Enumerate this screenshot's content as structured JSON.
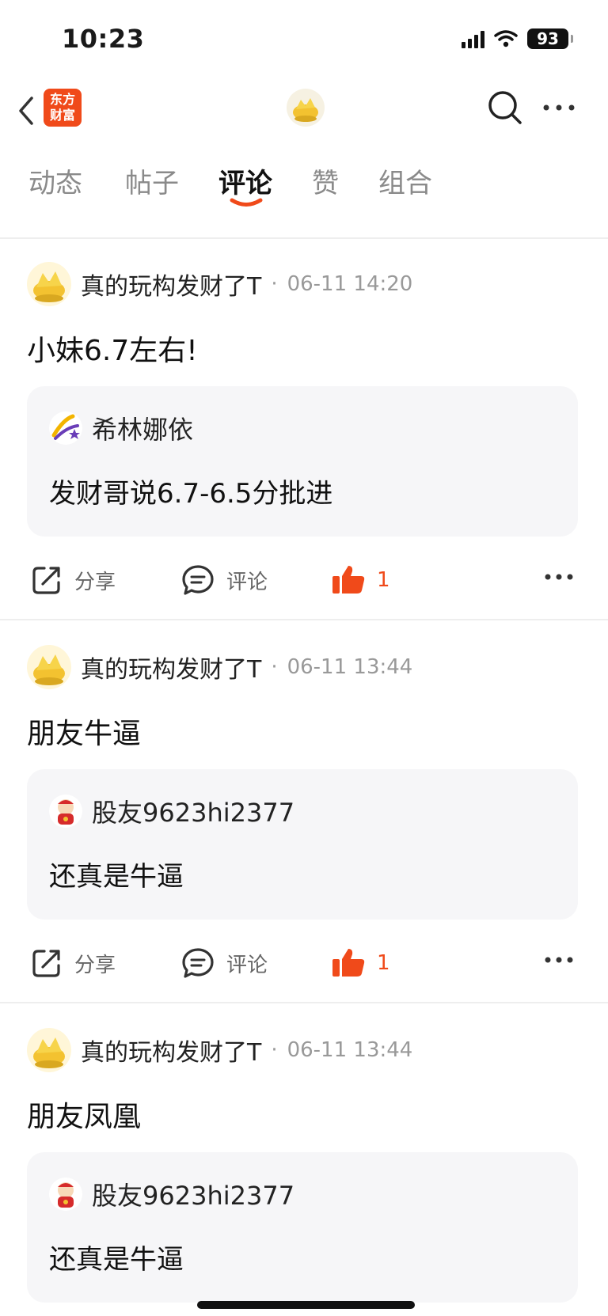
{
  "status_bar": {
    "time": "10:23",
    "battery": "93"
  },
  "header": {
    "brand_logo_text": [
      "东方",
      "财富"
    ],
    "brand_color": "#F04A1A",
    "icons": [
      "back-icon",
      "search-icon",
      "more-icon"
    ]
  },
  "tabs": [
    {
      "label": "动态",
      "active": false
    },
    {
      "label": "帖子",
      "active": false
    },
    {
      "label": "评论",
      "active": true
    },
    {
      "label": "赞",
      "active": false
    },
    {
      "label": "组合",
      "active": false
    }
  ],
  "posts": [
    {
      "author": "真的玩构发财了T",
      "separator": "·",
      "time": "06-11 14:20",
      "text": "小妹6.7左右!",
      "quote": {
        "name": "希林娜依",
        "text": "发财哥说6.7-6.5分批进",
        "avatar_icon": "star-logo-icon"
      },
      "actions": {
        "share": "分享",
        "comment": "评论",
        "likes": "1"
      }
    },
    {
      "author": "真的玩构发财了T",
      "separator": "·",
      "time": "06-11 13:44",
      "text": "朋友牛逼",
      "quote": {
        "name": "股友9623hi2377",
        "text": "还真是牛逼",
        "avatar_icon": "mascot-icon"
      },
      "actions": {
        "share": "分享",
        "comment": "评论",
        "likes": "1"
      }
    },
    {
      "author": "真的玩构发财了T",
      "separator": "·",
      "time": "06-11 13:44",
      "text": "朋友凤凰",
      "quote": {
        "name": "股友9623hi2377",
        "text": "还真是牛逼",
        "avatar_icon": "mascot-icon"
      }
    }
  ]
}
